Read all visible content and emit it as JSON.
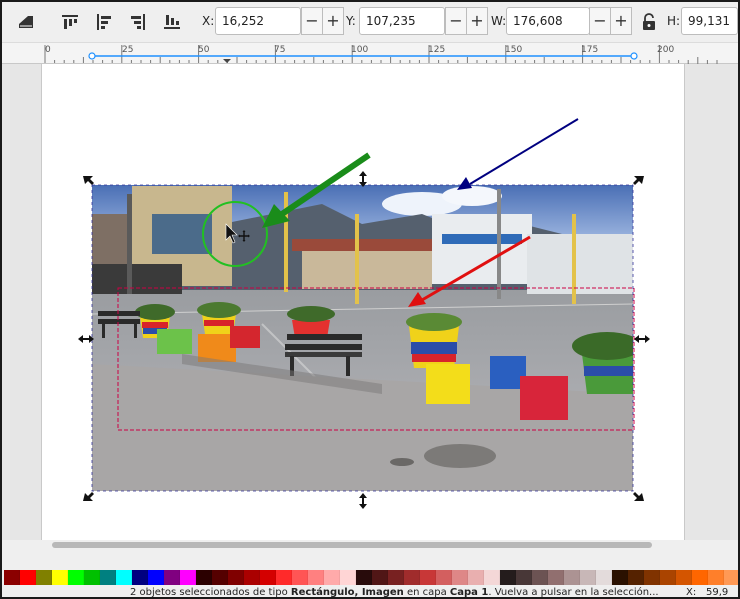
{
  "toolbar": {
    "x_label": "X:",
    "x_value": "16,252",
    "y_label": "Y:",
    "y_value": "107,235",
    "w_label": "W:",
    "w_value": "176,608",
    "h_label": "H:",
    "h_value": "99,131",
    "minus": "−",
    "plus": "+"
  },
  "ruler": {
    "ticks": [
      "0",
      "25",
      "50",
      "75",
      "100",
      "125",
      "150",
      "175",
      "200"
    ]
  },
  "status": {
    "text_pre": "2 objetos seleccionados de tipo ",
    "type_bold": "Rectángulo, Imagen",
    "text_mid": " en capa ",
    "layer_bold": "Capa 1",
    "text_post": ". Vuelva a pulsar en la selección...",
    "x_label": "X:",
    "x_value": "59,9"
  },
  "palette": {
    "colors": [
      "#8b0000",
      "#ff0000",
      "#808000",
      "#ffff00",
      "#00ff00",
      "#00c000",
      "#008080",
      "#00ffff",
      "#000080",
      "#0000ff",
      "#800080",
      "#ff00ff",
      "#2b0000",
      "#550000",
      "#800000",
      "#aa0000",
      "#d40000",
      "#ff2a2a",
      "#ff5555",
      "#ff8080",
      "#ffaaaa",
      "#ffd5d5",
      "#280b0b",
      "#501616",
      "#782121",
      "#a02c2c",
      "#c83737",
      "#d35f5f",
      "#de8787",
      "#e9afaf",
      "#f4d7d7",
      "#241c1c",
      "#483737",
      "#6c5353",
      "#916f6f",
      "#ac9393",
      "#c8b7b7",
      "#e3dbdb",
      "#2b1100",
      "#552200",
      "#803300",
      "#aa4400",
      "#d45500",
      "#ff6600",
      "#ff7f2a",
      "#ff9955",
      "#ffb380"
    ]
  },
  "colors": {
    "green_arrow": "#1a8c1a",
    "blue_arrow": "#000080",
    "red_arrow": "#e01010",
    "selection_dash": "#cc0044",
    "bbox_dash": "#333399"
  }
}
